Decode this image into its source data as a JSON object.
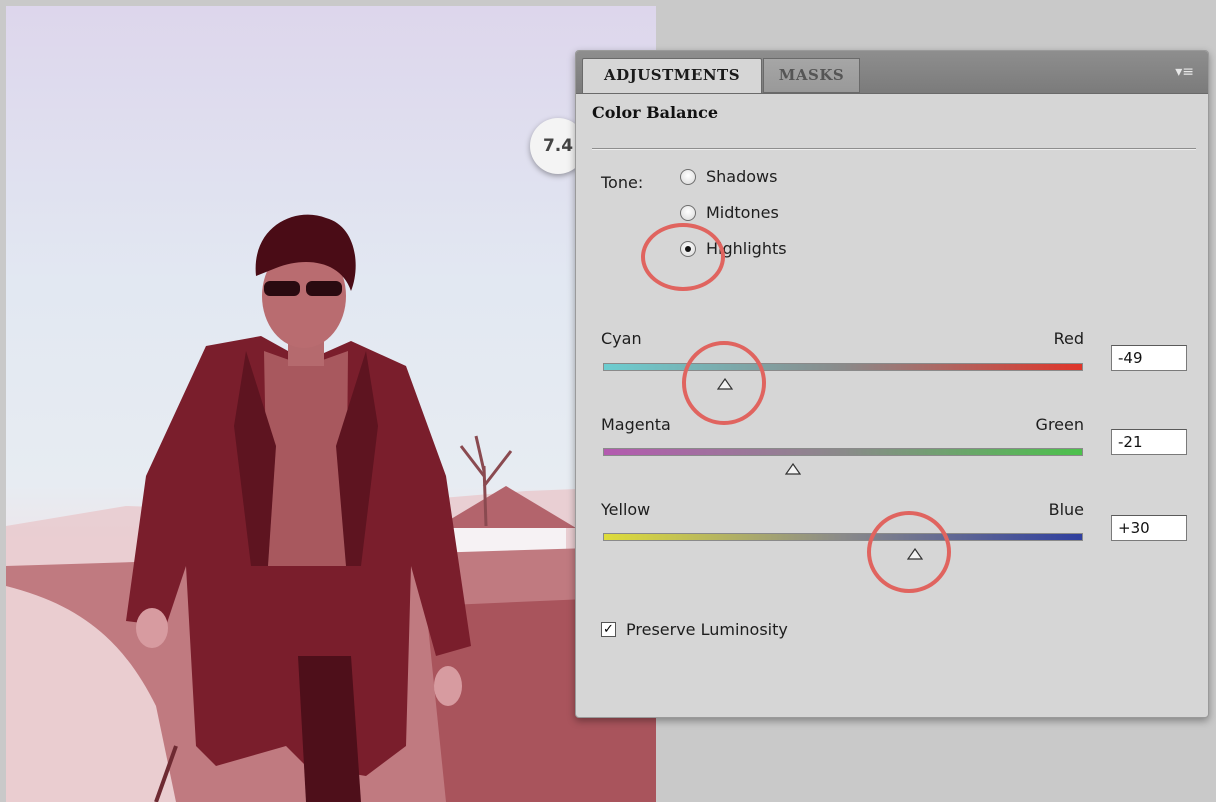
{
  "panel": {
    "tabs": [
      {
        "label": "ADJUSTMENTS",
        "active": true
      },
      {
        "label": "MASKS",
        "active": false
      }
    ],
    "menu_icon": "panel-menu-icon",
    "title": "Color Balance",
    "step_badge": "7.4",
    "tone": {
      "label": "Tone:",
      "options": [
        {
          "label": "Shadows",
          "selected": false
        },
        {
          "label": "Midtones",
          "selected": false
        },
        {
          "label": "Highlights",
          "selected": true
        }
      ]
    },
    "sliders": [
      {
        "left_label": "Cyan",
        "right_label": "Red",
        "value": "-49",
        "numeric": -49,
        "left_color": "#6ccdd0",
        "right_color": "#e0352a"
      },
      {
        "left_label": "Magenta",
        "right_label": "Green",
        "value": "-21",
        "numeric": -21,
        "left_color": "#b45ab0",
        "right_color": "#4cc14c"
      },
      {
        "left_label": "Yellow",
        "right_label": "Blue",
        "value": "+30",
        "numeric": 30,
        "left_color": "#dedc3a",
        "right_color": "#2f3f9f"
      }
    ],
    "preserve_luminosity": {
      "label": "Preserve Luminosity",
      "checked": true,
      "glyph": "✓"
    }
  },
  "annotation_color": "#e0645f"
}
